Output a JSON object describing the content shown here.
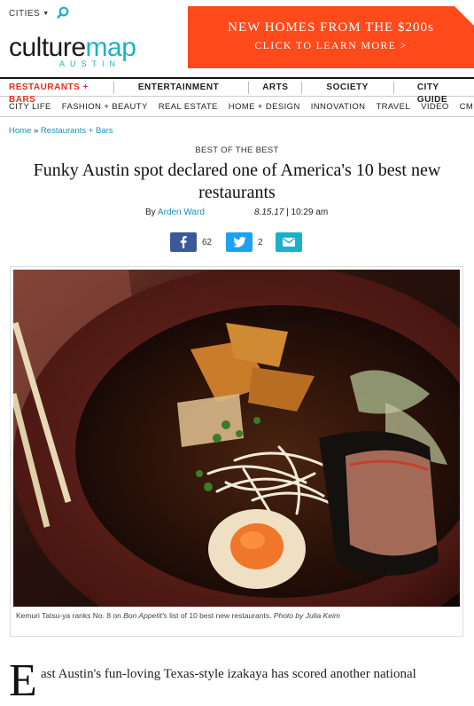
{
  "header": {
    "cities_label": "CITIES",
    "logo_word_a": "culture",
    "logo_word_b": "map",
    "logo_city": "AUSTIN",
    "ad": {
      "line1": "NEW HOMES FROM THE $200s",
      "line2": "CLICK TO LEARN MORE >"
    }
  },
  "nav_primary": [
    "RESTAURANTS + BARS",
    "ENTERTAINMENT",
    "ARTS",
    "SOCIETY",
    "CITY GUIDE"
  ],
  "nav_secondary": [
    "CITY LIFE",
    "FASHION + BEAUTY",
    "REAL ESTATE",
    "HOME + DESIGN",
    "INNOVATION",
    "TRAVEL",
    "VIDEO",
    "CM EV"
  ],
  "breadcrumb": {
    "home": "Home",
    "separator": "»",
    "section": "Restaurants + Bars"
  },
  "article": {
    "kicker": "BEST OF THE BEST",
    "headline": "Funky Austin spot declared one of America's 10 best new restaurants",
    "by_prefix": "By",
    "author": "Arden Ward",
    "date": "8.15.17",
    "time": "10:29 am",
    "share": {
      "facebook_count": "62",
      "twitter_count": "2"
    },
    "caption_a": "Kemuri Tatsu-ya ranks No. 8 on ",
    "caption_pub": "Bon Appetit's",
    "caption_b": " list of 10 best new restaurants.  ",
    "caption_credit": "Photo by Julia Keim",
    "dropcap": "E",
    "body_line1": "ast Austin's fun-loving Texas-style izakaya has scored another national"
  },
  "colors": {
    "accent": "#1bb0c9",
    "nav_active": "#e0301e",
    "ad_bg": "#ff4a1c",
    "facebook": "#3b5998",
    "twitter": "#1da1f2"
  }
}
